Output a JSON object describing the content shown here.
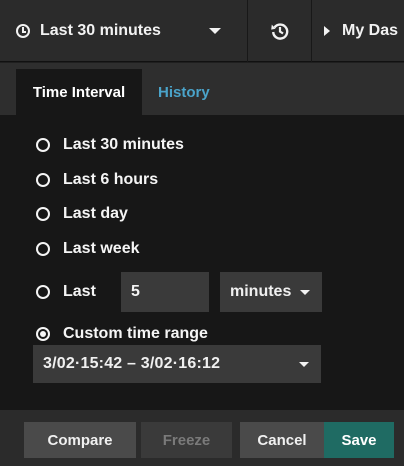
{
  "topbar": {
    "time_range_label": "Last 30 minutes",
    "dashboard_label": "My Das"
  },
  "tabs": [
    {
      "label": "Time Interval",
      "active": true
    },
    {
      "label": "History",
      "active": false
    }
  ],
  "options": {
    "last_30_minutes": "Last 30 minutes",
    "last_6_hours": "Last 6 hours",
    "last_day": "Last day",
    "last_week": "Last week",
    "last_custom": "Last",
    "custom_range": "Custom time range"
  },
  "selected_option": "custom_range",
  "last_custom": {
    "value": "5",
    "unit": "minutes"
  },
  "custom_range": {
    "value": "3/02·15:42 – 3/02·16:12"
  },
  "footer": {
    "compare": "Compare",
    "freeze": "Freeze",
    "cancel": "Cancel",
    "save": "Save"
  },
  "colors": {
    "accent_link": "#4aa3c9",
    "save_button": "#1f6b63"
  },
  "icons": {
    "time_range": "clock-icon",
    "history": "history-icon",
    "dashboard": "triangle-right-icon"
  }
}
